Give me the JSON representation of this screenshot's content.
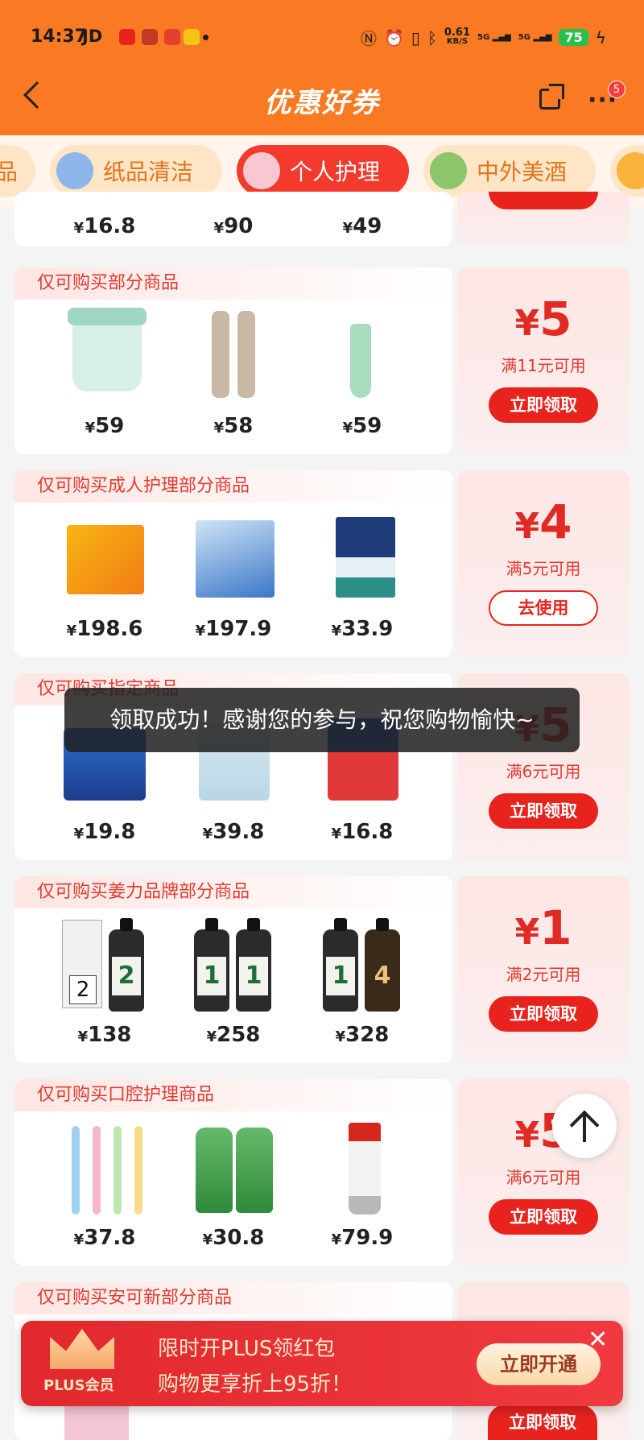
{
  "status_bar": {
    "time": "14:37",
    "carrier": "JD",
    "net_speed": "0.61",
    "net_unit": "KB/S",
    "sim1": "5G",
    "sim2": "5G",
    "battery": "75"
  },
  "header": {
    "title": "优惠好券",
    "badge_count": "5"
  },
  "tabs": [
    {
      "label": "品",
      "active": false
    },
    {
      "label": "纸品清洁",
      "active": false
    },
    {
      "label": "个人护理",
      "active": true
    },
    {
      "label": "中外美酒",
      "active": false
    }
  ],
  "top_partial_prices": [
    "16.8",
    "90",
    "49"
  ],
  "currency": "¥",
  "coupons": [
    {
      "heading": "仅可购买部分商品",
      "amount": "5",
      "condition": "满11元可用",
      "action": "立即领取",
      "products": [
        {
          "price": "59"
        },
        {
          "price": "58"
        },
        {
          "price": "59"
        }
      ]
    },
    {
      "heading": "仅可购买成人护理部分商品",
      "amount": "4",
      "condition": "满5元可用",
      "action": "去使用",
      "products": [
        {
          "price": "198.6"
        },
        {
          "price": "197.9"
        },
        {
          "price": "33.9"
        }
      ]
    },
    {
      "heading": "仅可购买指定商品",
      "amount": "5",
      "condition": "满6元可用",
      "action": "立即领取",
      "products": [
        {
          "price": "19.8"
        },
        {
          "price": "39.8"
        },
        {
          "price": "16.8"
        }
      ]
    },
    {
      "heading": "仅可购买姜力品牌部分商品",
      "amount": "1",
      "condition": "满2元可用",
      "action": "立即领取",
      "products": [
        {
          "price": "138"
        },
        {
          "price": "258"
        },
        {
          "price": "328"
        }
      ]
    },
    {
      "heading": "仅可购买口腔护理商品",
      "amount": "5",
      "condition": "满6元可用",
      "action": "立即领取",
      "products": [
        {
          "price": "37.8"
        },
        {
          "price": "30.8"
        },
        {
          "price": "79.9"
        }
      ]
    },
    {
      "heading": "仅可购买安可新部分商品",
      "action": "立即领取"
    }
  ],
  "toast": "领取成功！感谢您的参与，祝您购物愉快~",
  "plus_banner": {
    "label": "PLUS会员",
    "line1": "限时开PLUS领红包",
    "line2": "购物更享折上95折！",
    "button": "立即开通",
    "close": "✕"
  },
  "colors": {
    "header_bg": "#f97a22",
    "accent_red": "#e8231e",
    "tab_active": "#f33a2d"
  }
}
